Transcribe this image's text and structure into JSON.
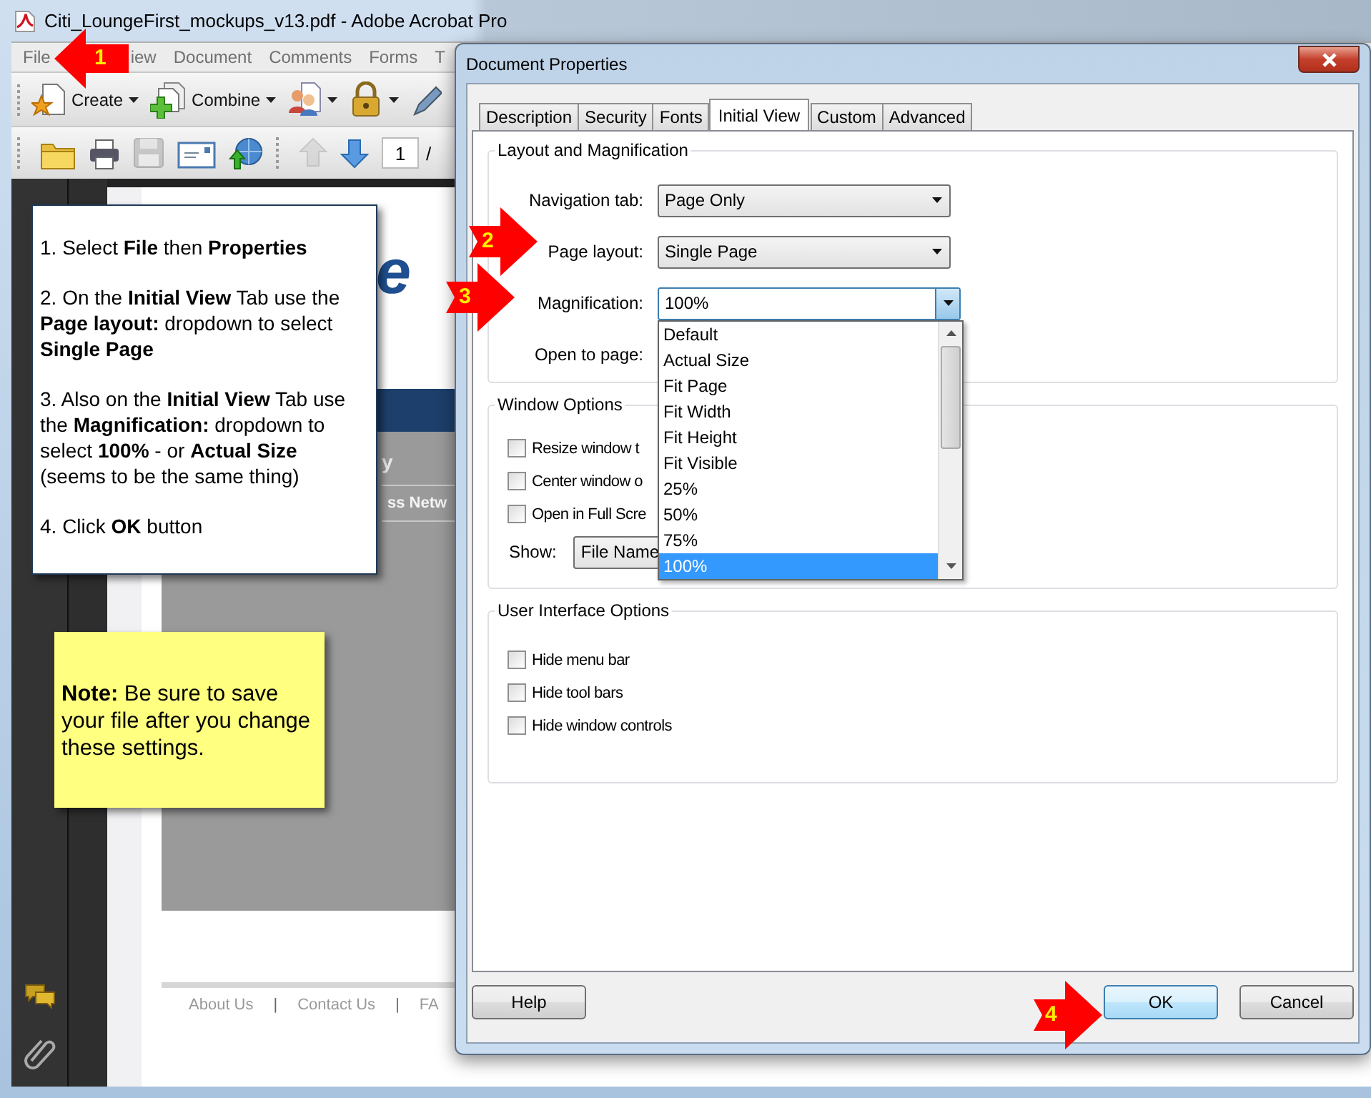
{
  "app_window": {
    "title": "Citi_LoungeFirst_mockups_v13.pdf - Adobe Acrobat Pro",
    "menu": [
      {
        "label": "File"
      },
      {
        "label": "iew"
      },
      {
        "label": "Document"
      },
      {
        "label": "Comments"
      },
      {
        "label": "Forms"
      },
      {
        "label": "T"
      }
    ],
    "toolbar": [
      {
        "kind": "create",
        "label": "Create",
        "has_menu": true
      },
      {
        "kind": "combine",
        "label": "Combine",
        "has_menu": true
      },
      {
        "kind": "collaborate",
        "has_menu": true
      },
      {
        "kind": "secure",
        "has_menu": true
      },
      {
        "kind": "sign",
        "has_menu": false
      }
    ],
    "nav_toolbar": [
      {
        "kind": "open",
        "disabled": false
      },
      {
        "kind": "print",
        "disabled": false
      },
      {
        "kind": "save",
        "disabled": true
      },
      {
        "kind": "email",
        "disabled": false
      },
      {
        "kind": "upload",
        "disabled": false
      },
      {
        "kind": "previous",
        "disabled": true
      },
      {
        "kind": "next",
        "disabled": false
      }
    ],
    "page_number": "1",
    "page_separator": "/",
    "side_panel": [
      {
        "kind": "comments"
      },
      {
        "kind": "attachments"
      }
    ],
    "document": {
      "logo_fragment": "e",
      "menu_fragment": "y",
      "band_fragment": "ss Netw",
      "footer_links": [
        {
          "kind": "link",
          "label": "About Us"
        },
        {
          "kind": "separator",
          "label": "|"
        },
        {
          "kind": "link",
          "label": "Contact Us"
        },
        {
          "kind": "separator",
          "label": "|"
        },
        {
          "kind": "link",
          "label": "FA"
        }
      ]
    }
  },
  "dialog": {
    "title": "Document Properties",
    "tabs": [
      {
        "label": "Description",
        "selected": false
      },
      {
        "label": "Security",
        "selected": false
      },
      {
        "label": "Fonts",
        "selected": false
      },
      {
        "label": "Initial View",
        "selected": true
      },
      {
        "label": "Custom",
        "selected": false
      },
      {
        "label": "Advanced",
        "selected": false
      }
    ],
    "groups": [
      {
        "title": "Layout and Magnification",
        "rows": [
          {
            "kind": "select",
            "label": "Navigation tab:",
            "value": "Page Only",
            "focused": false
          },
          {
            "kind": "select",
            "label": "Page layout:",
            "value": "Single Page",
            "focused": false
          },
          {
            "kind": "select",
            "label": "Magnification:",
            "value": "100%",
            "focused": true,
            "open": true,
            "options": [
              {
                "label": "Default",
                "selected": false
              },
              {
                "label": "Actual Size",
                "selected": false
              },
              {
                "label": "Fit Page",
                "selected": false
              },
              {
                "label": "Fit Width",
                "selected": false
              },
              {
                "label": "Fit Height",
                "selected": false
              },
              {
                "label": "Fit Visible",
                "selected": false
              },
              {
                "label": "25%",
                "selected": false
              },
              {
                "label": "50%",
                "selected": false
              },
              {
                "label": "75%",
                "selected": false
              },
              {
                "label": "100%",
                "selected": true
              }
            ]
          },
          {
            "kind": "label",
            "label": "Open to page:"
          }
        ]
      },
      {
        "title": "Window Options",
        "rows": [
          {
            "kind": "checkbox",
            "label": "Resize window t",
            "checked": false
          },
          {
            "kind": "checkbox",
            "label": "Center window o",
            "checked": false
          },
          {
            "kind": "checkbox",
            "label": "Open in Full Scre",
            "checked": false
          },
          {
            "kind": "inline_select",
            "label": "Show:",
            "value": "File Name"
          }
        ]
      },
      {
        "title": "User Interface Options",
        "rows": [
          {
            "kind": "checkbox",
            "label": "Hide menu bar",
            "checked": false
          },
          {
            "kind": "checkbox",
            "label": "Hide tool bars",
            "checked": false
          },
          {
            "kind": "checkbox",
            "label": "Hide window controls",
            "checked": false
          }
        ]
      }
    ],
    "buttons": [
      {
        "label": "Help",
        "default": false
      },
      {
        "label": "OK",
        "default": true
      },
      {
        "label": "Cancel",
        "default": false
      }
    ]
  },
  "instructions": [
    "1. Select **File** then **Properties**",
    "2. On the **Initial View** Tab use the **Page layout:** dropdown to select **Single Page**",
    "3. Also on the **Initial View** Tab use the **Magnification:** dropdown to select  **100%** - or **Actual Size** (seems to be the same thing)",
    "4. Click **OK** button"
  ],
  "note": "**Note:** Be sure to save your file after you change these settings.",
  "steps": [
    {
      "number": "1",
      "kind": "left"
    },
    {
      "number": "2",
      "kind": "right"
    },
    {
      "number": "3",
      "kind": "right"
    },
    {
      "number": "4",
      "kind": "right"
    }
  ]
}
